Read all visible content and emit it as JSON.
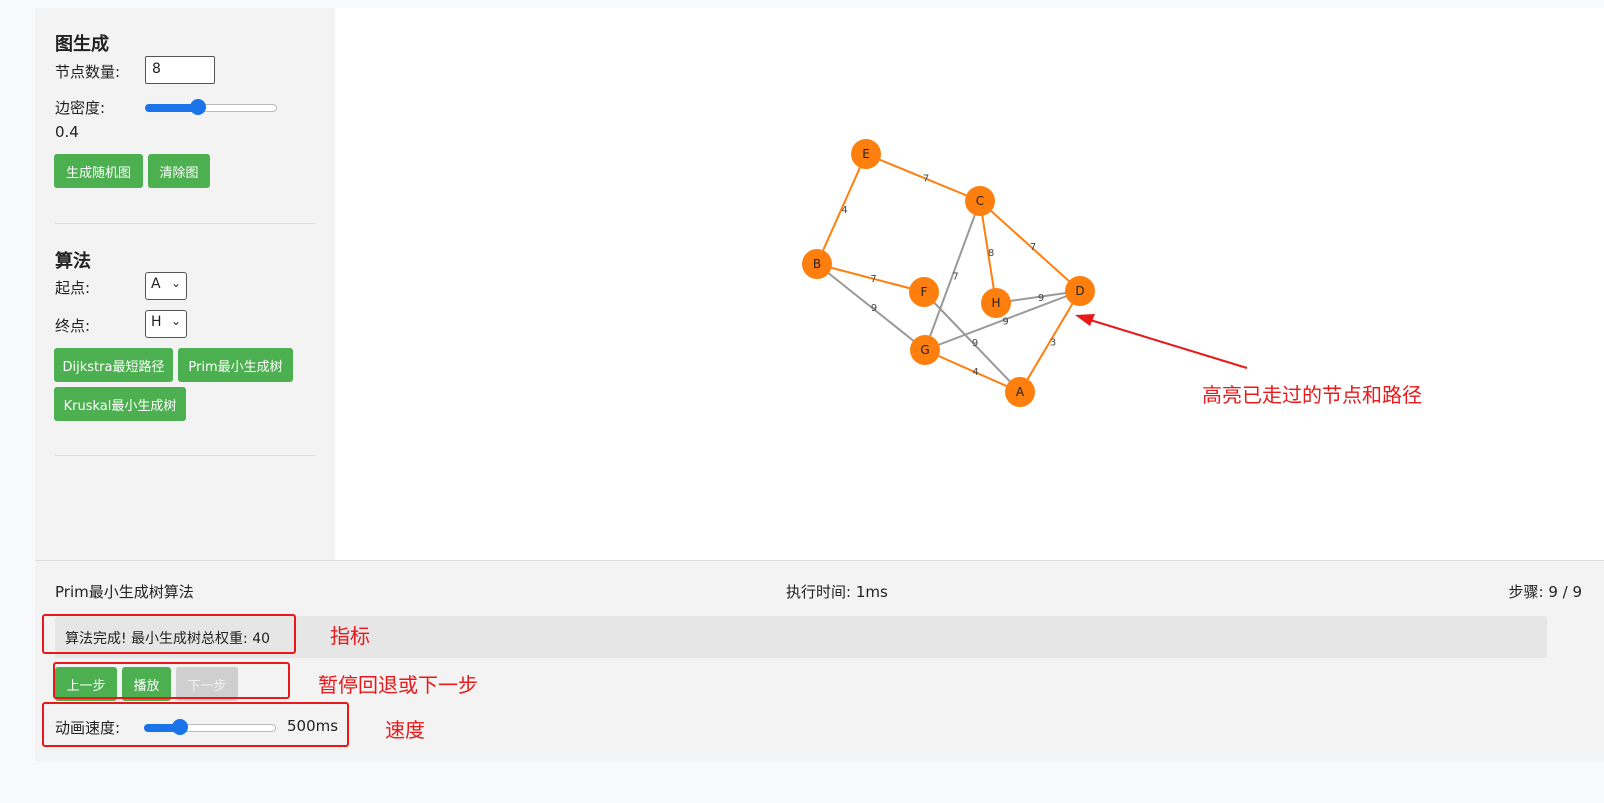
{
  "sidebar": {
    "graph_gen": {
      "heading": "图生成",
      "node_count_label": "节点数量:",
      "node_count_value": "8",
      "density_label": "边密度:",
      "density_value": "0.4",
      "density_fraction": 0.4,
      "generate_button": "生成随机图",
      "clear_button": "清除图"
    },
    "algorithm": {
      "heading": "算法",
      "start_label": "起点:",
      "start_value": "A",
      "end_label": "终点:",
      "end_value": "H",
      "dijkstra_button": "Dijkstra最短路径",
      "prim_button": "Prim最小生成树",
      "kruskal_button": "Kruskal最小生成树"
    }
  },
  "graph": {
    "nodes": [
      "A",
      "B",
      "C",
      "D",
      "E",
      "F",
      "G",
      "H"
    ],
    "edges": [
      {
        "from": "E",
        "to": "C",
        "weight": "7",
        "highlighted": true
      },
      {
        "from": "E",
        "to": "B",
        "weight": "4",
        "highlighted": true
      },
      {
        "from": "C",
        "to": "H",
        "weight": "8",
        "highlighted": true
      },
      {
        "from": "C",
        "to": "D",
        "weight": "7",
        "highlighted": true
      },
      {
        "from": "C",
        "to": "G",
        "weight": "7",
        "highlighted": false
      },
      {
        "from": "B",
        "to": "F",
        "weight": "7",
        "highlighted": true
      },
      {
        "from": "B",
        "to": "G",
        "weight": "9",
        "highlighted": false
      },
      {
        "from": "H",
        "to": "D",
        "weight": "9",
        "highlighted": false
      },
      {
        "from": "F",
        "to": "A",
        "weight": "9",
        "highlighted": false
      },
      {
        "from": "G",
        "to": "D",
        "weight": "9",
        "highlighted": false
      },
      {
        "from": "G",
        "to": "A",
        "weight": "4",
        "highlighted": true
      },
      {
        "from": "A",
        "to": "D",
        "weight": "3",
        "highlighted": true
      }
    ],
    "node_color": "#ff7f0e",
    "edge_highlight_color": "#ff7f0e",
    "edge_default_color": "#999999"
  },
  "status": {
    "algorithm_name": "Prim最小生成树算法",
    "exec_time": "执行时间: 1ms",
    "steps": "步骤: 9 / 9",
    "message": "算法完成! 最小生成树总权重: 40"
  },
  "controls": {
    "prev_button": "上一步",
    "play_button": "播放",
    "next_button": "下一步",
    "speed_label": "动画速度:",
    "speed_value": "500ms",
    "speed_fraction": 0.27
  },
  "annotations": {
    "highlight_note": "高亮已走过的节点和路径",
    "metrics_note": "指标",
    "step_note": "暂停回退或下一步",
    "speed_note": "速度"
  },
  "colors": {
    "accent": "#4caf50",
    "slider": "#1a73e8",
    "annotation": "#e8191a"
  }
}
